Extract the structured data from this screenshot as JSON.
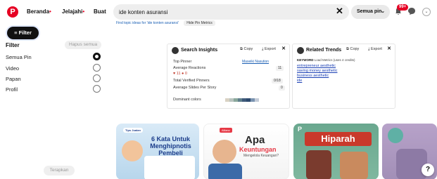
{
  "header": {
    "logo": "P",
    "nav": [
      {
        "label": "Beranda",
        "dot": "•"
      },
      {
        "label": "Jelajahi",
        "dot": "•"
      },
      {
        "label": "Buat",
        "dot": ""
      }
    ],
    "search_value": "ide konten asuransi",
    "search_clear": "✕",
    "scope_label": "Semua pin",
    "scope_chevron": "⌄",
    "notif_badge": "99+",
    "account_chevron": "⌄"
  },
  "subbar": {
    "link1": "Find topic ideas for 'ide konten asuransi'",
    "chip": "Hide Pin Metrics"
  },
  "sidebar": {
    "filter_button": "Filter",
    "filter_title": "Filter",
    "clear_all": "Hapus semua",
    "options": [
      {
        "label": "Semua Pin",
        "selected": true
      },
      {
        "label": "Video",
        "selected": false
      },
      {
        "label": "Papan",
        "selected": false
      },
      {
        "label": "Profil",
        "selected": false
      }
    ],
    "apply": "Terapkan"
  },
  "search_insights": {
    "title": "Search Insights",
    "copy": "Copy",
    "export": "Export",
    "close": "✕",
    "top_pinner_label": "Top Pinner",
    "top_pinner_value": "Maseiki Nasution",
    "avg_reactions_label": "Average Reactions",
    "avg_reactions_value": "11",
    "reactions_breakdown": "♥ 11  ● 0",
    "verified_label": "Total Verified Pinners",
    "verified_value": "0/18",
    "slides_label": "Average Slides Per Story",
    "slides_value": "0",
    "dominant_label": "Dominant colors",
    "colors": [
      "#d9d2c4",
      "#b9c4bf",
      "#8aa89c",
      "#5f7f8c",
      "#3e5a7a",
      "#2d4a6e",
      "#7a93b0",
      "#c4ccd8"
    ]
  },
  "related_trends": {
    "title": "Related Trends",
    "copy": "Copy",
    "export": "Export",
    "close": "✕",
    "keyword_label": "KEYWORD",
    "metrics_note": "Load Metrics (uses 4 credits)",
    "links": [
      "entrepreneur aesthetic",
      "saving money aesthetic",
      "business aesthetic",
      "ide"
    ]
  },
  "pins": {
    "pin1_tag": "Tips Jualan",
    "pin1_title": "6 Kata Untuk Menghipnotis Pembeli",
    "pin2_tag": "Allianz",
    "pin2_title": "Apa",
    "pin2_subtitle": "Keuntungan",
    "pin2_caption": "Mengelola Keuangan?",
    "pin3_logo": "P",
    "pin3_title": "Hiparah"
  },
  "help": "?"
}
